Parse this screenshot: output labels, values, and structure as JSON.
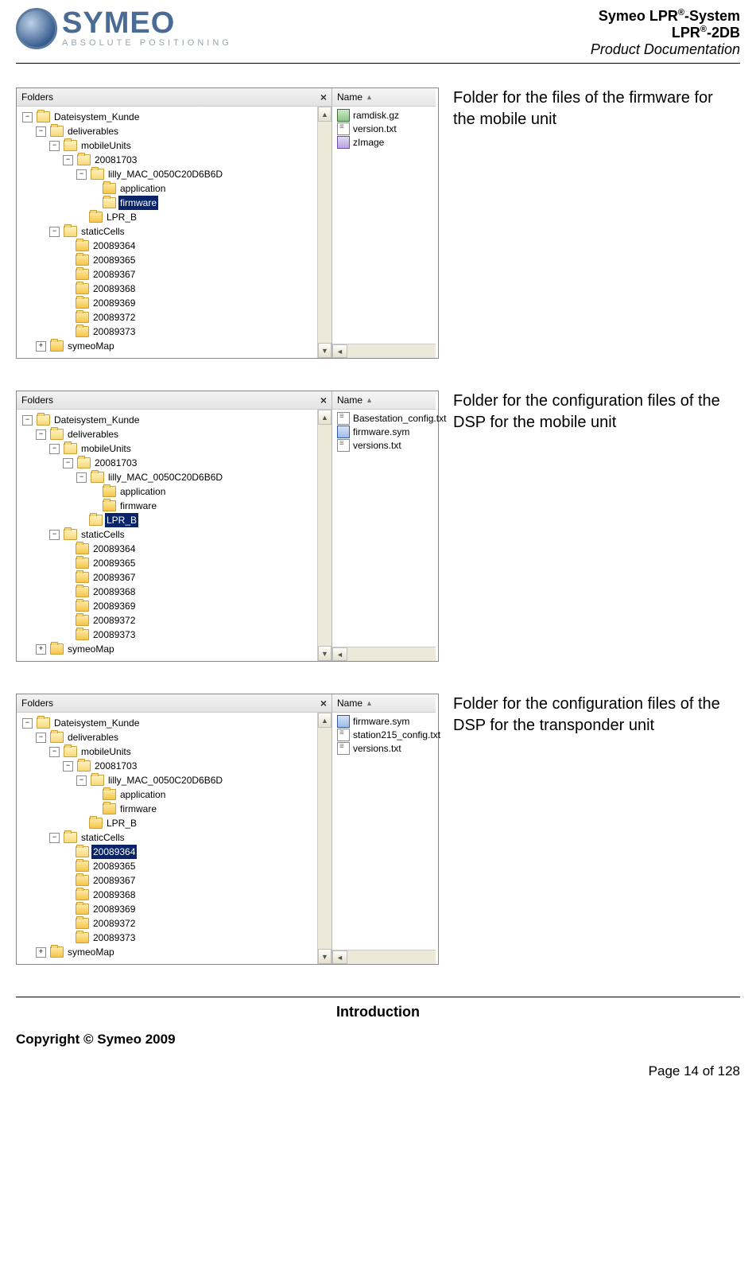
{
  "brand": {
    "name": "SYMEO",
    "tagline": "ABSOLUTE POSITIONING"
  },
  "doc": {
    "line1a": "Symeo LPR",
    "line1b": "-System",
    "line2a": "LPR",
    "line2b": "-2DB",
    "line3": "Product Documentation"
  },
  "ui": {
    "foldersHeader": "Folders",
    "nameHeader": "Name",
    "closeX": "×",
    "minus": "−",
    "plus": "+",
    "up": "▲",
    "down": "▼",
    "left": "◄"
  },
  "captions": {
    "c1": "Folder for the files of the firmware for the mobile unit",
    "c2": "Folder for the configuration files of the DSP for the mobile unit",
    "c3": "Folder for the configuration files of the DSP for the transponder unit"
  },
  "trees": {
    "common": {
      "root": "Dateisystem_Kunde",
      "deliverables": "deliverables",
      "mobileUnits": "mobileUnits",
      "date": "20081703",
      "mac": "lilly_MAC_0050C20D6B6D",
      "application": "application",
      "firmware": "firmware",
      "lprb": "LPR_B",
      "staticCells": "staticCells",
      "cells": [
        "20089364",
        "20089365",
        "20089367",
        "20089368",
        "20089369",
        "20089372",
        "20089373"
      ],
      "symeoMap": "symeoMap"
    }
  },
  "files": {
    "set1": [
      {
        "name": "ramdisk.gz",
        "icon": "gz"
      },
      {
        "name": "version.txt",
        "icon": "txt"
      },
      {
        "name": "zImage",
        "icon": "img"
      }
    ],
    "set2": [
      {
        "name": "Basestation_config.txt",
        "icon": "txt"
      },
      {
        "name": "firmware.sym",
        "icon": "sym"
      },
      {
        "name": "versions.txt",
        "icon": "txt"
      }
    ],
    "set3": [
      {
        "name": "firmware.sym",
        "icon": "sym"
      },
      {
        "name": "station215_config.txt",
        "icon": "txt"
      },
      {
        "name": "versions.txt",
        "icon": "txt"
      }
    ]
  },
  "footer": {
    "section": "Introduction",
    "copyright": "Copyright © Symeo 2009",
    "page": "Page 14 of 128"
  }
}
